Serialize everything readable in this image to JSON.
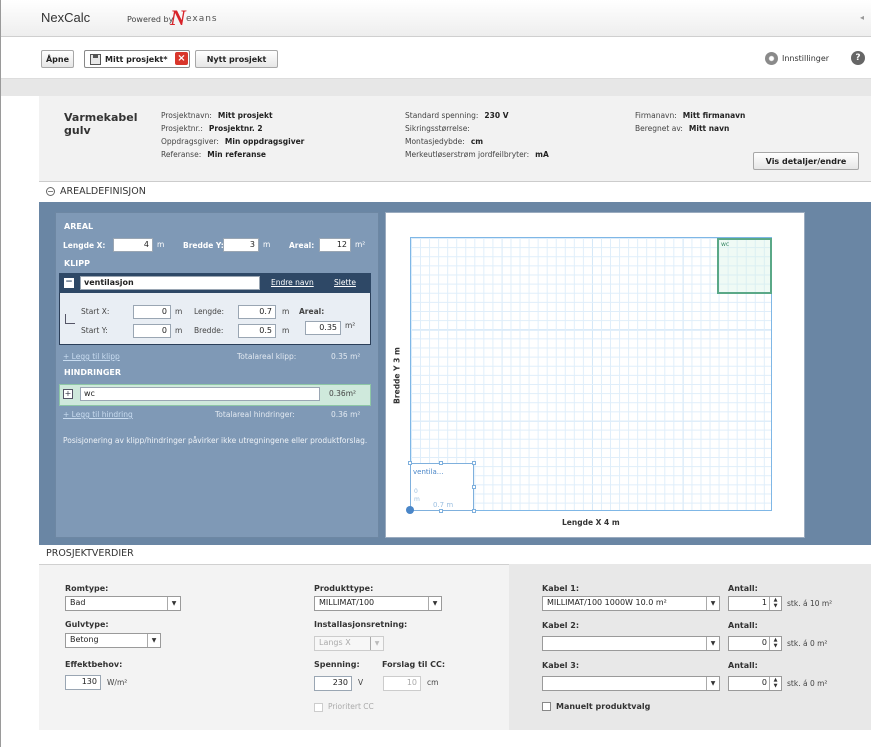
{
  "app": {
    "logo": "NexCalc",
    "powered_by": "Powered by",
    "brand_mark": "N",
    "brand_rest": "exans"
  },
  "tabs": {
    "open": "Åpne",
    "active": "Mitt prosjekt*",
    "new": "Nytt prosjekt",
    "settings": "Innstillinger",
    "help": "?"
  },
  "project": {
    "title": "Varmekabel gulv",
    "details_button": "Vis detaljer/endre",
    "col1": [
      {
        "label": "Prosjektnavn:",
        "value": "Mitt prosjekt"
      },
      {
        "label": "Prosjektnr.:",
        "value": "Prosjektnr. 2"
      },
      {
        "label": "Oppdragsgiver:",
        "value": "Min oppdragsgiver"
      },
      {
        "label": "Referanse:",
        "value": "Min referanse"
      }
    ],
    "col2": [
      {
        "label": "Standard spenning:",
        "value": "230 V"
      },
      {
        "label": "Sikringsstørrelse:",
        "value": ""
      },
      {
        "label": "Montasjedybde:",
        "value": "cm"
      },
      {
        "label": "Merkeutløserstrøm jordfeilbryter:",
        "value": "mA"
      }
    ],
    "col3": [
      {
        "label": "Firmanavn:",
        "value": "Mitt firmanavn"
      },
      {
        "label": "Beregnet av:",
        "value": "Mitt navn"
      }
    ]
  },
  "areal_section": {
    "title": "AREALDEFINISJON",
    "collapse": "−",
    "areal_label": "AREAL",
    "lengde_x_label": "Lengde X:",
    "lengde_x": "4",
    "bredde_y_label": "Bredde Y:",
    "bredde_y": "3",
    "unit_m": "m",
    "areal_total_label": "Areal:",
    "areal_total": "12",
    "unit_m2": "m²",
    "klipp_label": "KLIPP",
    "klipp_name": "ventilasjon",
    "rename": "Endre navn",
    "delete": "Slette",
    "start_x_label": "Start X:",
    "start_x": "0",
    "start_y_label": "Start Y:",
    "start_y": "0",
    "lengde_label": "Lengde:",
    "lengde": "0.7",
    "bredde_label": "Bredde:",
    "bredde": "0.5",
    "klipp_areal_label": "Areal:",
    "klipp_areal": "0.35",
    "add_klipp": "+ Legg til klipp",
    "total_klipp_label": "Totalareal klipp:",
    "total_klipp": "0.35 m²",
    "hind_label": "HINDRINGER",
    "hind_name": "wc",
    "hind_area": "0.36m²",
    "add_hind": "+ Legg til hindring",
    "total_hind_label": "Totalareal hindringer:",
    "total_hind": "0.36 m²",
    "hint": "Posisjonering av klipp/hindringer påvirker ikke utregningene eller produktforslag.",
    "canvas": {
      "wc_label": "wc",
      "vent_label": "ventila...",
      "vent_h": "0",
      "vent_h2": "m",
      "vent_w": "0.7 m",
      "x_axis": "Lengde X 4 m",
      "y_axis": "Bredde Y 3 m"
    }
  },
  "prosjekt_section": {
    "title": "PROSJEKTVERDIER",
    "romtype_label": "Romtype:",
    "romtype": "Bad",
    "gulvtype_label": "Gulvtype:",
    "gulvtype": "Betong",
    "effekt_label": "Effektbehov:",
    "effekt": "130",
    "effekt_unit": "W/m²",
    "produkttype_label": "Produkttype:",
    "produkttype": "MILLIMAT/100",
    "install_label": "Installasjonsretning:",
    "install": "Langs X",
    "spenning_label": "Spenning:",
    "spenning": "230",
    "spenning_unit": "V",
    "forslag_label": "Forslag til CC:",
    "forslag": "10",
    "forslag_unit": "cm",
    "prioritert": "Prioritert CC",
    "kabel1_label": "Kabel 1:",
    "kabel1": "MILLIMAT/100 1000W 10.0 m²",
    "kabel2_label": "Kabel 2:",
    "kabel2": "",
    "kabel3_label": "Kabel 3:",
    "kabel3": "",
    "antall_label": "Antall:",
    "antall1": "1",
    "antall2": "0",
    "antall3": "0",
    "stk1": "stk. á 10 m²",
    "stk2": "stk. á 0 m²",
    "stk3": "stk. á 0 m²",
    "manuelt": "Manuelt produktvalg"
  }
}
